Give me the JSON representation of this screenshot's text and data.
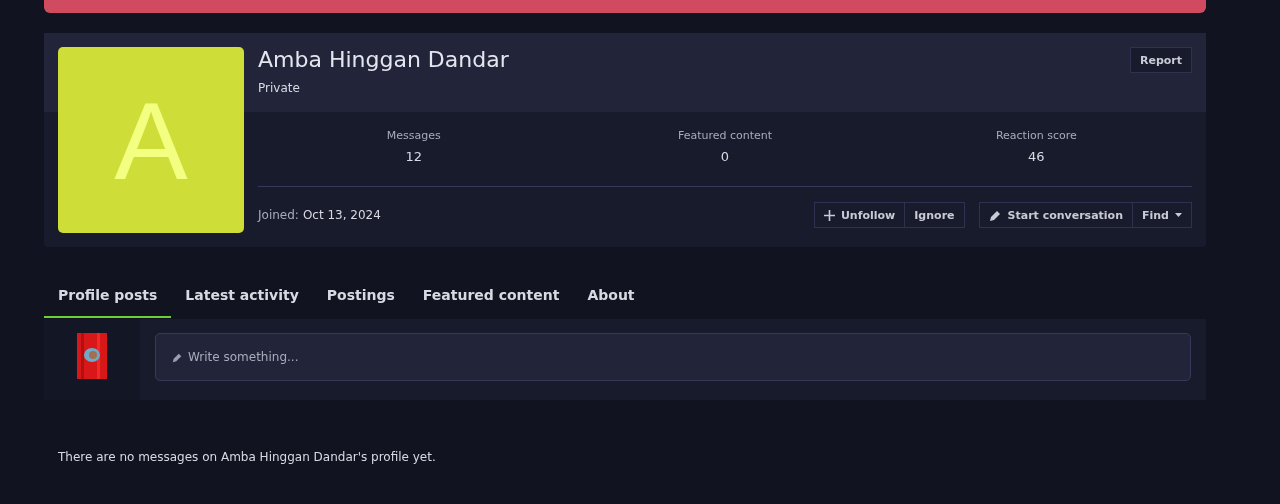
{
  "profile": {
    "avatar_letter": "A",
    "name": "Amba Hinggan Dandar",
    "user_title": "Private",
    "report_button": "Report",
    "stats": [
      {
        "label": "Messages",
        "value": "12"
      },
      {
        "label": "Featured content",
        "value": "0"
      },
      {
        "label": "Reaction score",
        "value": "46"
      }
    ],
    "joined_label": "Joined:",
    "joined_date": "Oct 13, 2024",
    "follow_buttons": [
      {
        "kind": "plus",
        "label": "Unfollow"
      },
      {
        "kind": "plain",
        "label": "Ignore"
      }
    ],
    "contact_buttons": [
      {
        "kind": "pen",
        "label": "Start conversation"
      },
      {
        "kind": "menu",
        "label": "Find"
      }
    ]
  },
  "tabs": [
    {
      "label": "Profile posts",
      "selected": true
    },
    {
      "label": "Latest activity",
      "selected": false
    },
    {
      "label": "Postings",
      "selected": false
    },
    {
      "label": "Featured content",
      "selected": false
    },
    {
      "label": "About",
      "selected": false
    }
  ],
  "composer": {
    "placeholder": "Write something..."
  },
  "empty_message": "There are no messages on Amba Hinggan Dandar's profile yet."
}
